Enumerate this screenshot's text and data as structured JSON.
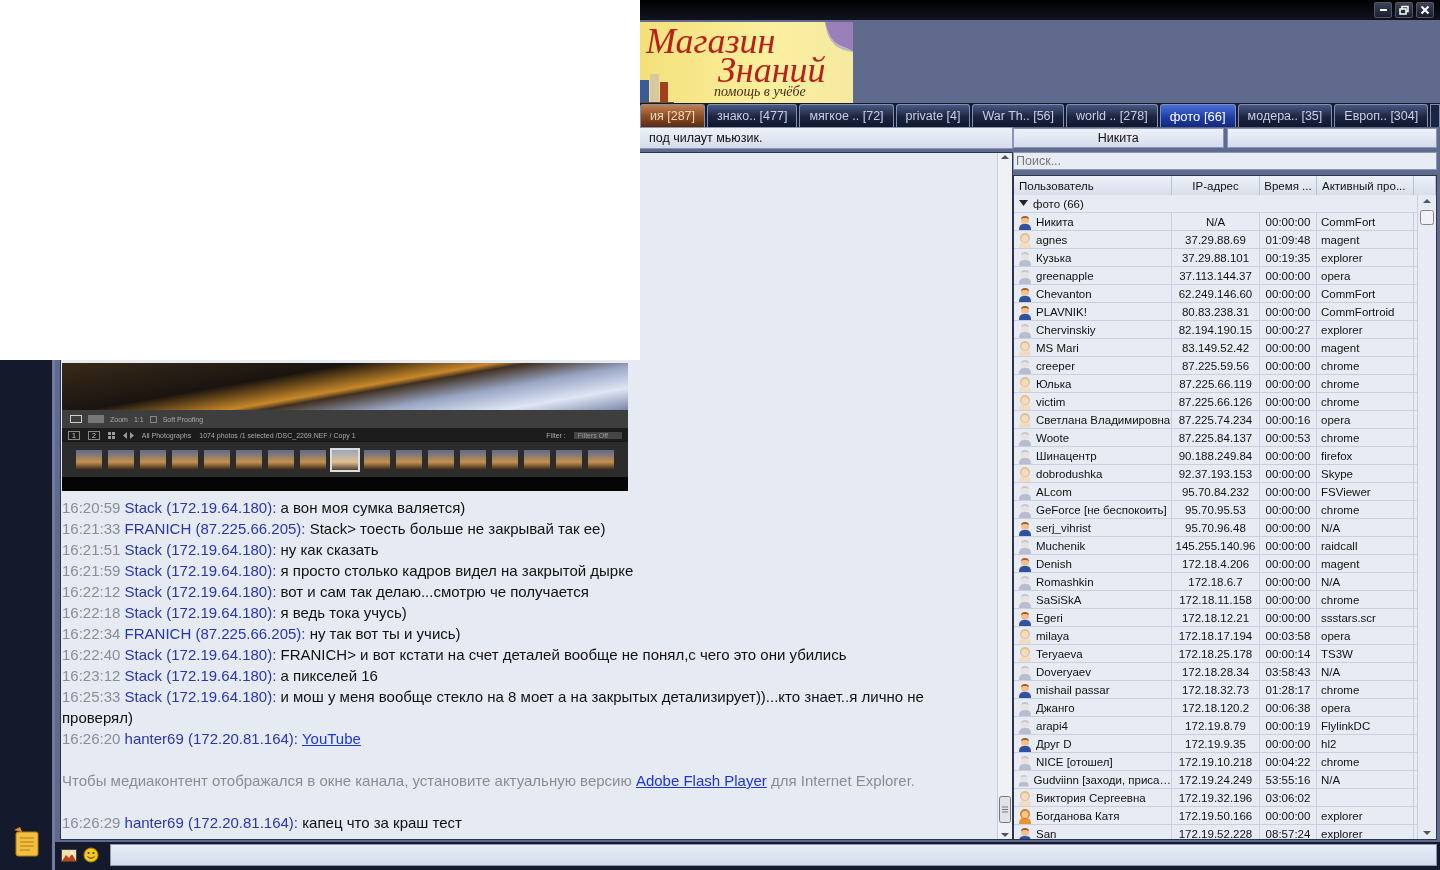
{
  "banner": {
    "line_1": "Магазин",
    "line_2": "Знаний",
    "line_3": "помощь в учёбе"
  },
  "tabs": [
    {
      "label": "ия [287]",
      "selected": false,
      "alert": true
    },
    {
      "label": "знако.. [477]",
      "selected": false,
      "alert": false
    },
    {
      "label": "мягкое .. [72]",
      "selected": false,
      "alert": false
    },
    {
      "label": "private [4]",
      "selected": false,
      "alert": false
    },
    {
      "label": "War Th.. [56]",
      "selected": false,
      "alert": false
    },
    {
      "label": "world .. [278]",
      "selected": false,
      "alert": false
    },
    {
      "label": "фото [66]",
      "selected": true,
      "alert": false
    },
    {
      "label": "модера.. [35]",
      "selected": false,
      "alert": false
    },
    {
      "label": "Европ.. [304]",
      "selected": false,
      "alert": false
    }
  ],
  "topic": "под чилаут мьюзик.",
  "chat": {
    "image": {
      "zoom_label": "Zoom",
      "zoom_value": "1:1",
      "soft_proofing": "Soft Proofing",
      "soft_proofing_checked": false,
      "view_1": "1",
      "view_2": "2",
      "source": "All Photographs",
      "selection": "1074 photos /1 selected /DSC_2269.NEF / Copy 1",
      "filter_label": "Filter :",
      "filter_value": "Filters Off",
      "thumbnails": [
        {
          "selected": false
        },
        {
          "selected": false
        },
        {
          "selected": false
        },
        {
          "selected": false
        },
        {
          "selected": false
        },
        {
          "selected": false
        },
        {
          "selected": false
        },
        {
          "selected": false
        },
        {
          "selected": true
        },
        {
          "selected": false
        },
        {
          "selected": false
        },
        {
          "selected": false
        },
        {
          "selected": false
        },
        {
          "selected": false
        },
        {
          "selected": false
        },
        {
          "selected": false
        },
        {
          "selected": false
        }
      ]
    },
    "messages": [
      {
        "kind": "message",
        "time": "16:20:59",
        "author": "Stack (172.19.64.180):",
        "text": "а вон моя сумка валяется)"
      },
      {
        "kind": "message",
        "time": "16:21:33",
        "author": "FRANICH (87.225.66.205):",
        "text": "Stack> тоесть больше не закрывай так ее)"
      },
      {
        "kind": "message",
        "time": "16:21:51",
        "author": "Stack (172.19.64.180):",
        "text": "ну как сказать"
      },
      {
        "kind": "message",
        "time": "16:21:59",
        "author": "Stack (172.19.64.180):",
        "text": "я просто столько кадров видел на закрытой дырке"
      },
      {
        "kind": "message",
        "time": "16:22:12",
        "author": "Stack (172.19.64.180):",
        "text": "вот и сам так делаю...смотрю че получается"
      },
      {
        "kind": "message",
        "time": "16:22:18",
        "author": "Stack (172.19.64.180):",
        "text": "я ведь тока учусь)"
      },
      {
        "kind": "message",
        "time": "16:22:34",
        "author": "FRANICH (87.225.66.205):",
        "text": "ну так вот ты и учись)"
      },
      {
        "kind": "message",
        "time": "16:22:40",
        "author": "Stack (172.19.64.180):",
        "text": "FRANICH> и вот кстати на счет деталей вообще не понял,с чего это они убились"
      },
      {
        "kind": "message",
        "time": "16:23:12",
        "author": "Stack (172.19.64.180):",
        "text": "а пикселей 16"
      },
      {
        "kind": "message",
        "time": "16:25:33",
        "author": "Stack (172.19.64.180):",
        "text": "и мош у меня вообще стекло на 8 моет а на закрытых детализирует))...кто знает..я лично не проверял)"
      },
      {
        "kind": "link",
        "time": "16:26:20",
        "author": "hanter69 (172.20.81.164):",
        "link": "YouTube"
      },
      {
        "kind": "notice",
        "before": "Чтобы медиаконтент отображался в окне канала, установите актуальную версию",
        "link": "Adobe Flash Player",
        "after": "для Internet Explorer."
      },
      {
        "kind": "message",
        "time": "16:26:29",
        "author": "hanter69 (172.20.81.164):",
        "text": "капец что за краш тест"
      }
    ]
  },
  "user_header": {
    "name": "Никита"
  },
  "search": {
    "placeholder": "Поиск..."
  },
  "users": {
    "columns": [
      "Пользователь",
      "IP-адрес",
      "Время ...",
      "Активный про..."
    ],
    "group": {
      "label": "фото (66)",
      "expanded": true
    },
    "rows": [
      {
        "kind": "male",
        "name": "Никита",
        "ip": "N/A",
        "time": "00:00:00",
        "process": "CommFort"
      },
      {
        "kind": "female",
        "name": "agnes",
        "ip": "37.29.88.69",
        "time": "01:09:48",
        "process": "magent"
      },
      {
        "kind": "male-away",
        "name": "Кузька",
        "ip": "37.29.88.101",
        "time": "00:19:35",
        "process": "explorer"
      },
      {
        "kind": "male-away",
        "name": "greenapple",
        "ip": "37.113.144.37",
        "time": "00:00:00",
        "process": "opera"
      },
      {
        "kind": "male",
        "name": "Chevanton",
        "ip": "62.249.146.60",
        "time": "00:00:00",
        "process": "CommFort"
      },
      {
        "kind": "male",
        "name": "PLAVNIK!",
        "ip": "80.83.238.31",
        "time": "00:00:00",
        "process": "CommFortroid"
      },
      {
        "kind": "male-away",
        "name": "Chervinskiy",
        "ip": "82.194.190.15",
        "time": "00:00:27",
        "process": "explorer"
      },
      {
        "kind": "female",
        "name": "MS Mari",
        "ip": "83.149.52.42",
        "time": "00:00:00",
        "process": "magent"
      },
      {
        "kind": "male-away",
        "name": "creeper",
        "ip": "87.225.59.56",
        "time": "00:00:00",
        "process": "chrome"
      },
      {
        "kind": "female",
        "name": "Юлька",
        "ip": "87.225.66.119",
        "time": "00:00:00",
        "process": "chrome"
      },
      {
        "kind": "female",
        "name": "victim",
        "ip": "87.225.66.126",
        "time": "00:00:00",
        "process": "chrome"
      },
      {
        "kind": "female",
        "name": "Светлана Владимировна",
        "ip": "87.225.74.234",
        "time": "00:00:16",
        "process": "opera"
      },
      {
        "kind": "male-away",
        "name": "Woote",
        "ip": "87.225.84.137",
        "time": "00:00:53",
        "process": "chrome"
      },
      {
        "kind": "male-away",
        "name": "Шинацентр",
        "ip": "90.188.249.84",
        "time": "00:00:00",
        "process": "firefox"
      },
      {
        "kind": "female",
        "name": "dobrodushka",
        "ip": "92.37.193.153",
        "time": "00:00:00",
        "process": "Skype"
      },
      {
        "kind": "male-away",
        "name": "ALcom",
        "ip": "95.70.84.232",
        "time": "00:00:00",
        "process": "FSViewer"
      },
      {
        "kind": "male-away",
        "name": "GeForce [не беспокоить]",
        "ip": "95.70.95.53",
        "time": "00:00:00",
        "process": "chrome"
      },
      {
        "kind": "male",
        "name": "serj_vihrist",
        "ip": "95.70.96.48",
        "time": "00:00:00",
        "process": "N/A"
      },
      {
        "kind": "male-away",
        "name": "Muchenik",
        "ip": "145.255.140.96",
        "time": "00:00:00",
        "process": "raidcall"
      },
      {
        "kind": "male",
        "name": "Denish",
        "ip": "172.18.4.206",
        "time": "00:00:00",
        "process": "magent"
      },
      {
        "kind": "male-away",
        "name": "Romashkin",
        "ip": "172.18.6.7",
        "time": "00:00:00",
        "process": "N/A"
      },
      {
        "kind": "male-away",
        "name": "SaSiSkA",
        "ip": "172.18.11.158",
        "time": "00:00:00",
        "process": "chrome"
      },
      {
        "kind": "male",
        "name": "Egeri",
        "ip": "172.18.12.21",
        "time": "00:00:00",
        "process": "ssstars.scr"
      },
      {
        "kind": "female",
        "name": "milaya",
        "ip": "172.18.17.194",
        "time": "00:03:58",
        "process": "opera"
      },
      {
        "kind": "female",
        "name": "Teryaeva",
        "ip": "172.18.25.178",
        "time": "00:00:14",
        "process": "TS3W"
      },
      {
        "kind": "male-away",
        "name": "Doveryaev",
        "ip": "172.18.28.34",
        "time": "03:58:43",
        "process": "N/A"
      },
      {
        "kind": "male",
        "name": "mishail passar",
        "ip": "172.18.32.73",
        "time": "01:28:17",
        "process": "chrome"
      },
      {
        "kind": "male-away",
        "name": "Джанго",
        "ip": "172.18.120.2",
        "time": "00:06:38",
        "process": "opera"
      },
      {
        "kind": "male-away",
        "name": "arapi4",
        "ip": "172.19.8.79",
        "time": "00:00:19",
        "process": "FlylinkDC"
      },
      {
        "kind": "male",
        "name": "Друг D",
        "ip": "172.19.9.35",
        "time": "00:00:00",
        "process": "hl2"
      },
      {
        "kind": "male-away",
        "name": "NICE [отошел]",
        "ip": "172.19.10.218",
        "time": "00:04:22",
        "process": "chrome"
      },
      {
        "kind": "male-away",
        "name": "Gudviinn [заходи, приса…",
        "ip": "172.19.24.249",
        "time": "53:55:16",
        "process": "N/A"
      },
      {
        "kind": "female",
        "name": "Виктория Сергеевна",
        "ip": "172.19.32.196",
        "time": "03:06:02"
      },
      {
        "kind": "female-active",
        "name": "Богданова Катя",
        "ip": "172.19.50.166",
        "time": "00:00:00",
        "process": "explorer"
      },
      {
        "kind": "male",
        "name": "San",
        "ip": "172.19.52.228",
        "time": "08:57:24",
        "process": "explorer"
      }
    ]
  }
}
